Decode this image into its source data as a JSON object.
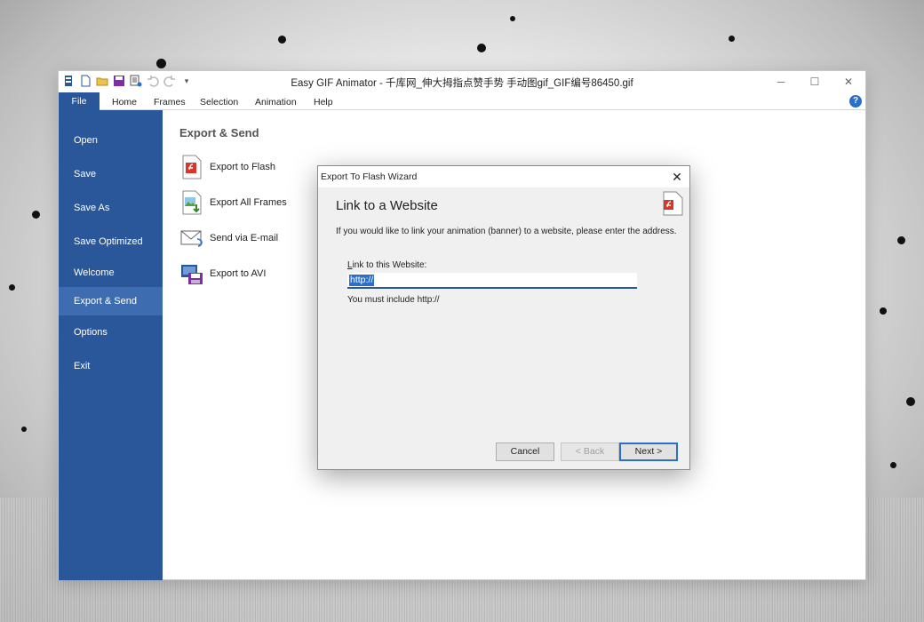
{
  "window": {
    "title": "Easy GIF Animator - 千库网_伸大拇指点赞手势 手动图gif_GIF编号86450.gif",
    "controls": {
      "minimize": "─",
      "maximize": "☐",
      "close": "✕"
    }
  },
  "ribbon": {
    "file_tab": "File",
    "tabs": [
      "Home",
      "Frames",
      "Selection",
      "Animation",
      "Help"
    ],
    "help_glyph": "?"
  },
  "sidebar": {
    "items": [
      {
        "label": "Open"
      },
      {
        "label": "Save"
      },
      {
        "label": "Save As"
      },
      {
        "label": "Save Optimized"
      },
      {
        "label": "Welcome"
      },
      {
        "label": "Export & Send",
        "active": true
      },
      {
        "label": "Options"
      },
      {
        "label": "Exit"
      }
    ]
  },
  "main": {
    "section_title": "Export & Send",
    "items": [
      {
        "label": "Export to Flash",
        "icon": "flash-file-icon"
      },
      {
        "label": "Export All Frames",
        "icon": "image-export-icon"
      },
      {
        "label": "Send via E-mail",
        "icon": "email-icon"
      },
      {
        "label": "Export to AVI",
        "icon": "avi-video-icon"
      }
    ]
  },
  "dialog": {
    "title": "Export To Flash Wizard",
    "close_glyph": "✕",
    "heading": "Link to a Website",
    "description": "If you would like to link your animation (banner) to a website, please enter the address.",
    "field_label_accel": "L",
    "field_label_rest": "ink to this Website:",
    "field_value": "http://",
    "hint": "You must include http://",
    "buttons": {
      "cancel": "Cancel",
      "back": "< Back",
      "next": "Next >"
    }
  },
  "colors": {
    "accent": "#2a579a",
    "accent_active": "#3d6db0",
    "selection": "#2a6fca",
    "flash_red": "#d9362b"
  }
}
